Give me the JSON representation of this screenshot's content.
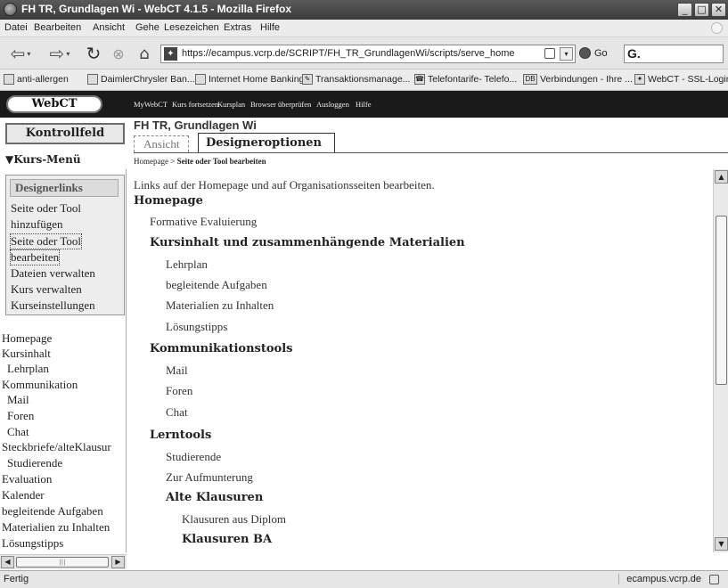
{
  "window": {
    "title": "FH TR, Grundlagen Wi - WebCT 4.1.5 - Mozilla Firefox",
    "controls": [
      "_",
      "□",
      "✕"
    ]
  },
  "menubar": [
    "Datei",
    "Bearbeiten",
    "Ansicht",
    "Gehe",
    "Lesezeichen",
    "Extras",
    "Hilfe"
  ],
  "toolbar": {
    "url": "https://ecampus.vcrp.de/SCRIPT/FH_TR_GrundlagenWi/scripts/serve_home",
    "go_label": "Go",
    "search_value": "G."
  },
  "bookmarks": [
    "anti-allergen",
    "DaimlerChrysler Ban...",
    "Internet Home Banking",
    "Transaktionsmanage...",
    "Telefontarife- Telefo...",
    "Verbindungen - Ihre ...",
    "WebCT - SSL-Login"
  ],
  "webct": {
    "logo": "WebCT",
    "topnav": [
      "MyWebCT",
      "Kurs fortsetzen",
      "Kursplan",
      "Browser überprüfen",
      "Ausloggen",
      "Hilfe"
    ]
  },
  "header": {
    "kontrollfeld": "Kontrollfeld",
    "course_title": "FH TR, Grundlagen Wi",
    "tabs": [
      "Ansicht",
      "Designeroptionen"
    ],
    "kurs_menu": "▼Kurs-Menü"
  },
  "breadcrumb": {
    "home": "Homepage",
    "sep": ">",
    "current": "Seite oder Tool bearbeiten"
  },
  "designer_links": {
    "heading": "Designerlinks",
    "items": [
      "Seite oder Tool",
      "hinzufügen",
      "Seite oder Tool",
      "bearbeiten",
      "Dateien verwalten",
      "Kurs verwalten",
      "Kurseinstellungen"
    ]
  },
  "course_nav": [
    "Homepage",
    "Kursinhalt",
    "Lehrplan",
    "Kommunikation",
    "Mail",
    "Foren",
    "Chat",
    "Steckbriefe/alteKlausur",
    "Studierende",
    "Evaluation",
    "Kalender",
    "begleitende Aufgaben",
    "Materialien zu Inhalten",
    "Lösungstipps"
  ],
  "main": {
    "intro": "Links auf der Homepage und auf Organisationsseiten bearbeiten.",
    "home_heading": "Homepage",
    "items": [
      "Formative Evaluierung",
      "Kursinhalt und zusammenhängende Materialien",
      "Lehrplan",
      "begleitende Aufgaben",
      "Materialien zu Inhalten",
      "Lösungstipps",
      "Kommunikationstools",
      "Mail",
      "Foren",
      "Chat",
      "Lerntools",
      "Studierende",
      "Zur Aufmunterung",
      "Alte Klausuren",
      "Klausuren aus Diplom",
      "Klausuren BA"
    ]
  },
  "status": {
    "text": "Fertig",
    "domain": "ecampus.vcrp.de"
  }
}
